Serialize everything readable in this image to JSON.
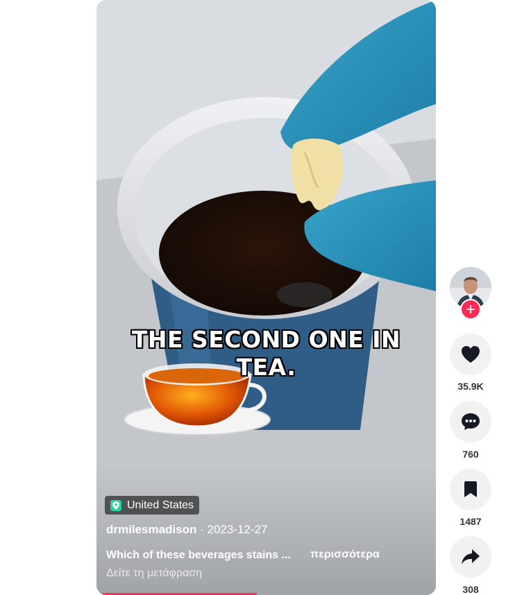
{
  "video": {
    "caption_line1": "THE SECOND ONE IN",
    "caption_line2": "TEA.",
    "location": "United States",
    "author": "drmilesmadison",
    "date": "2023-12-27",
    "description": "Which of these beverages stains ...",
    "more_label": "περισσότερα",
    "translate_label": "Δείτε τη μετάφραση",
    "progress_fraction": 0.46
  },
  "actions": {
    "likes": "35.9K",
    "comments": "760",
    "saves": "1487",
    "shares": "308"
  },
  "colors": {
    "accent": "#fe2c55",
    "location_icon": "#20d5a0",
    "button_bg": "#f1f1f2"
  }
}
